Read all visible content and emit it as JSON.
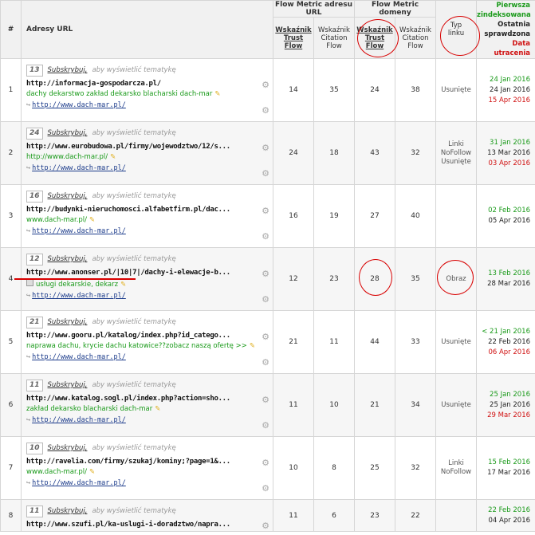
{
  "headers": {
    "num": "#",
    "url": "Adresy URL",
    "group_url": "Flow Metric adresu URL",
    "group_domain": "Flow Metric domeny",
    "tf": [
      "Wskaźnik",
      "Trust",
      "Flow"
    ],
    "cf": [
      "Wskaźnik",
      "Citation",
      "Flow"
    ],
    "type": [
      "Typ",
      "linku"
    ],
    "dates": {
      "first": [
        "Pierwsza",
        "zindeksowana"
      ],
      "last": [
        "Ostatnia",
        "sprawdzona"
      ],
      "lost": "Data utracenia"
    }
  },
  "subscribe_label": "Subskrybuj,",
  "subscribe_hint": "aby wyświetlić tematykę",
  "target_arrow": "↪",
  "rows": [
    {
      "num": "1",
      "topic": "13",
      "url": "http://informacja-gospodarcza.pl/",
      "anchor": "dachy dekarstwo zakład dekarsko blacharski dach-mar",
      "target": "http://www.dach-mar.pl/",
      "tf": "14",
      "cf": "35",
      "dtf": "24",
      "dcf": "38",
      "type": [
        "Usunięte"
      ],
      "first": "24 Jan 2016",
      "last": "24 Jan 2016",
      "lost": "15 Apr 2016",
      "first_prefix": ""
    },
    {
      "num": "2",
      "topic": "24",
      "url": "http://www.eurobudowa.pl/firmy/wojewodztwo/12/s...",
      "anchor": "http://www.dach-mar.pl/",
      "target": "http://www.dach-mar.pl/",
      "tf": "24",
      "cf": "18",
      "dtf": "43",
      "dcf": "32",
      "type": [
        "Linki",
        "NoFollow",
        "Usunięte"
      ],
      "first": "31 Jan 2016",
      "last": "13 Mar 2016",
      "lost": "03 Apr 2016",
      "first_prefix": ""
    },
    {
      "num": "3",
      "topic": "16",
      "url": "http://budynki-nieruchomosci.alfabetfirm.pl/dac...",
      "anchor": "www.dach-mar.pl/",
      "target": "http://www.dach-mar.pl/",
      "tf": "16",
      "cf": "19",
      "dtf": "27",
      "dcf": "40",
      "type": [],
      "first": "02 Feb 2016",
      "last": "05 Apr 2016",
      "lost": "",
      "first_prefix": ""
    },
    {
      "num": "4",
      "topic": "12",
      "url": "http://www.anonser.pl/|10|7|/dachy-i-elewacje-b...",
      "anchor": "usługi dekarskie, dekarz",
      "target": "http://www.dach-mar.pl/",
      "tf": "12",
      "cf": "23",
      "dtf": "28",
      "dcf": "35",
      "type": [
        "Obraz"
      ],
      "first": "13 Feb 2016",
      "last": "28 Mar 2016",
      "lost": "",
      "first_prefix": ""
    },
    {
      "num": "5",
      "topic": "21",
      "url": "http://www.gooru.pl/katalog/index.php?id_catego...",
      "anchor": "naprawa dachu, krycie dachu katowice??zobacz naszą ofertę >>",
      "target": "http://www.dach-mar.pl/",
      "tf": "21",
      "cf": "11",
      "dtf": "44",
      "dcf": "33",
      "type": [
        "Usunięte"
      ],
      "first": "21 Jan 2016",
      "last": "22 Feb 2016",
      "lost": "06 Apr 2016",
      "first_prefix": "<"
    },
    {
      "num": "6",
      "topic": "11",
      "url": "http://www.katalog.sogl.pl/index.php?action=sho...",
      "anchor": "zakład dekarsko blacharski dach-mar",
      "target": "http://www.dach-mar.pl/",
      "tf": "11",
      "cf": "10",
      "dtf": "21",
      "dcf": "34",
      "type": [
        "Usunięte"
      ],
      "first": "25 Jan 2016",
      "last": "25 Jan 2016",
      "lost": "29 Mar 2016",
      "first_prefix": ""
    },
    {
      "num": "7",
      "topic": "10",
      "url": "http://ravelia.com/firmy/szukaj/kominy;?page=1&...",
      "anchor": "www.dach-mar.pl/",
      "target": "http://www.dach-mar.pl/",
      "tf": "10",
      "cf": "8",
      "dtf": "25",
      "dcf": "32",
      "type": [
        "Linki",
        "NoFollow"
      ],
      "first": "15 Feb 2016",
      "last": "17 Mar 2016",
      "lost": "",
      "first_prefix": ""
    },
    {
      "num": "8",
      "topic": "11",
      "url": "http://www.szufi.pl/ka-uslugi-i-doradztwo/napra...",
      "anchor": "",
      "target": "",
      "tf": "11",
      "cf": "6",
      "dtf": "23",
      "dcf": "22",
      "type": [],
      "first": "22 Feb 2016",
      "last": "04 Apr 2016",
      "lost": "",
      "first_prefix": ""
    }
  ],
  "colors": {
    "green": "#1a9a1a",
    "red": "#d01010",
    "circle": "#d80000"
  }
}
